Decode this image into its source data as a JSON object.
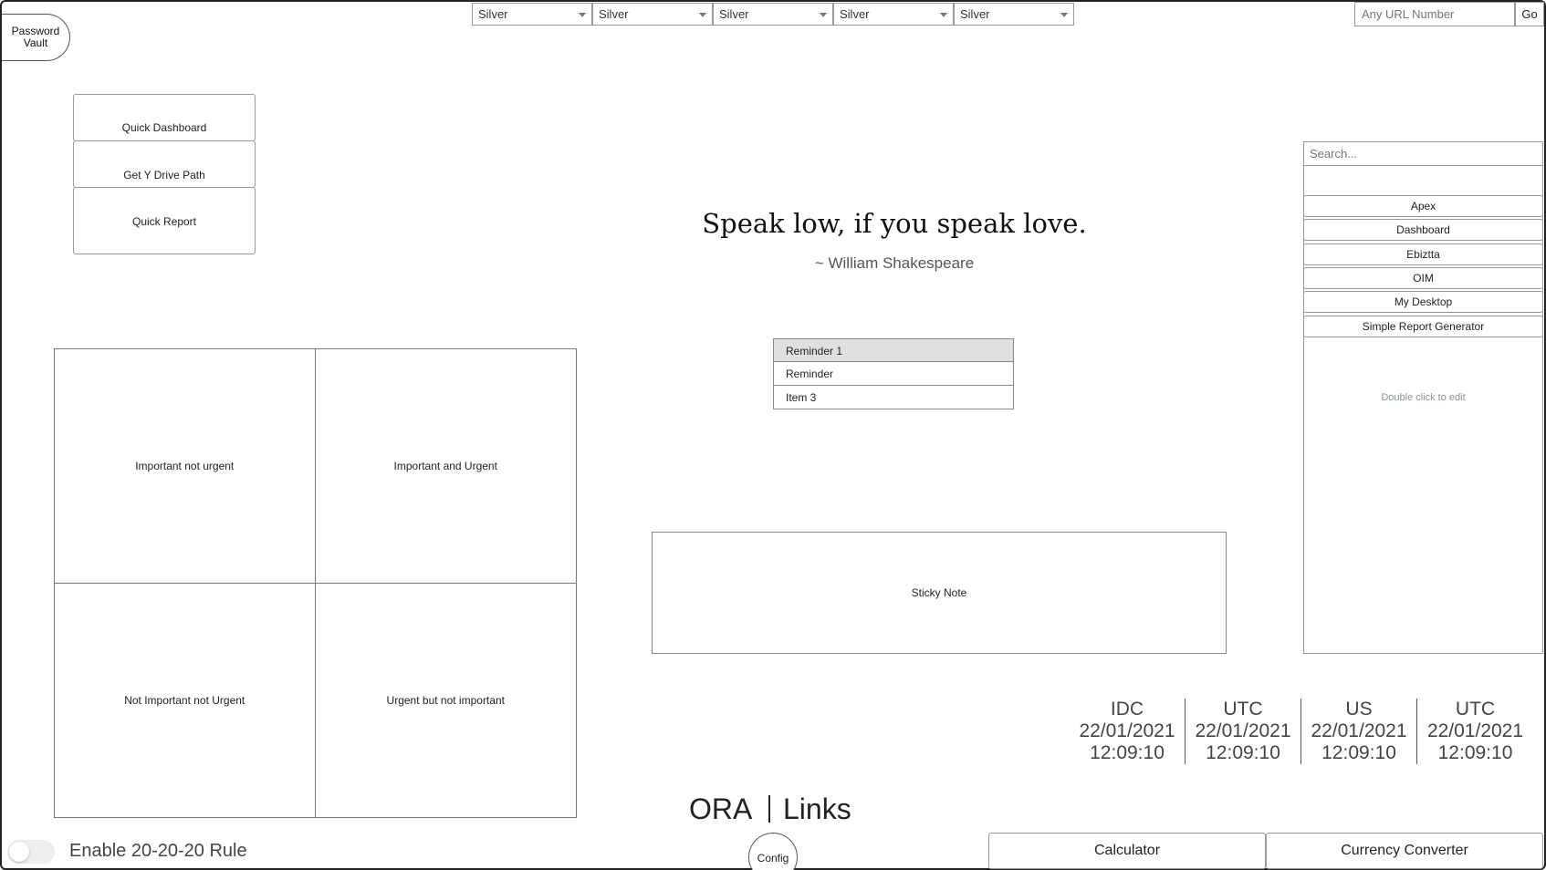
{
  "vault": {
    "label": "Password Vault"
  },
  "selects": [
    {
      "value": "Silver"
    },
    {
      "value": "Silver"
    },
    {
      "value": "Silver"
    },
    {
      "value": "Silver"
    },
    {
      "value": "Silver"
    }
  ],
  "url": {
    "placeholder": "Any URL Number",
    "go_label": "Go"
  },
  "quick_actions": [
    {
      "label": "Quick Dashboard"
    },
    {
      "label": "Get Y Drive Path"
    },
    {
      "label": "Quick Report"
    }
  ],
  "quote": {
    "text": "Speak low, if you speak love.",
    "author": "~ William Shakespeare"
  },
  "reminders": [
    {
      "label": "Reminder 1"
    },
    {
      "label": "Reminder"
    },
    {
      "label": "Item 3"
    }
  ],
  "matrix": {
    "top_left": "Important not urgent",
    "top_right": "Important and Urgent",
    "bottom_left": "Not Important not Urgent",
    "bottom_right": "Urgent but not important"
  },
  "sticky_note": {
    "label": "Sticky Note"
  },
  "links_panel": {
    "search_placeholder": "Search...",
    "items": [
      {
        "label": "Apex"
      },
      {
        "label": "Dashboard"
      },
      {
        "label": "Ebiztta"
      },
      {
        "label": "OIM"
      },
      {
        "label": "My Desktop"
      },
      {
        "label": "Simple Report Generator"
      }
    ],
    "hint": "Double click to edit"
  },
  "clocks": [
    {
      "zone": "IDC",
      "date": "22/01/2021",
      "time": "12:09:10"
    },
    {
      "zone": "UTC",
      "date": "22/01/2021",
      "time": "12:09:10"
    },
    {
      "zone": "US",
      "date": "22/01/2021",
      "time": "12:09:10"
    },
    {
      "zone": "UTC",
      "date": "22/01/2021",
      "time": "12:09:10"
    }
  ],
  "brand": {
    "left": "ORA",
    "right": "Links"
  },
  "config": {
    "label": "Config"
  },
  "rule_toggle": {
    "label": "Enable 20-20-20 Rule",
    "enabled": false
  },
  "bottom_buttons": {
    "calculator": "Calculator",
    "currency": "Currency Converter"
  }
}
